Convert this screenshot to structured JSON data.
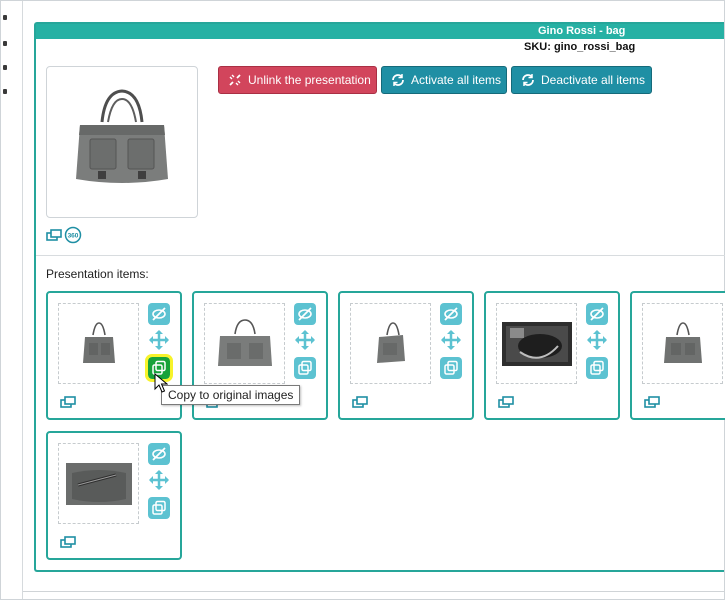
{
  "product": {
    "title": "Gino Rossi - bag",
    "sku_label": "SKU: gino_rossi_bag"
  },
  "actions": {
    "unlink_label": "Unlink the presentation",
    "activate_label": "Activate all items",
    "deactivate_label": "Deactivate all items"
  },
  "section": {
    "items_title": "Presentation items:"
  },
  "items": [
    {
      "image": "bag-front-small",
      "copy_active": true
    },
    {
      "image": "bag-front",
      "copy_active": false
    },
    {
      "image": "bag-side",
      "copy_active": false
    },
    {
      "image": "bag-inside",
      "copy_active": false
    },
    {
      "image": "bag-back",
      "copy_active": false
    },
    {
      "image": "bag-pocket-detail",
      "copy_active": false
    }
  ],
  "tooltip": {
    "text": "Copy to original images"
  },
  "icons": {
    "hide": "eye-slash-icon",
    "move": "move-arrows-icon",
    "copy": "copy-icon",
    "link": "link-icon",
    "view360": "view-360-icon",
    "unlink": "unlink-icon",
    "refresh": "refresh-icon"
  },
  "colors": {
    "accent": "#26a69a",
    "danger": "#d2455c",
    "primary": "#1f8fa4",
    "icon_button": "#5cc2d1",
    "copy_active": "#18a23a",
    "highlight": "#f7f32a"
  }
}
